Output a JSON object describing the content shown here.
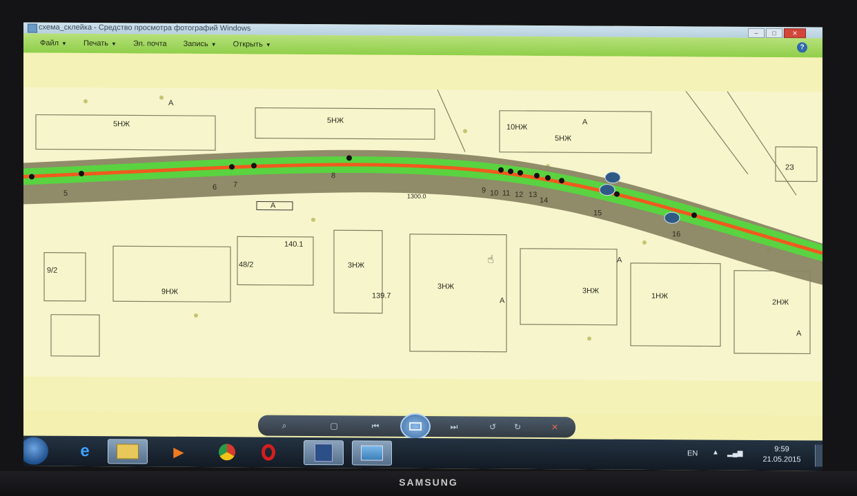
{
  "window": {
    "title": "схема_склейка - Средство просмотра фотографий Windows",
    "controls": {
      "minimize": "–",
      "maximize": "□",
      "close": "✕"
    }
  },
  "menu": {
    "items": [
      {
        "label": "Файл",
        "has_dropdown": true
      },
      {
        "label": "Печать",
        "has_dropdown": true
      },
      {
        "label": "Эл. почта",
        "has_dropdown": false
      },
      {
        "label": "Запись",
        "has_dropdown": true
      },
      {
        "label": "Открыть",
        "has_dropdown": true
      }
    ],
    "help_icon": "?"
  },
  "map": {
    "building_labels": [
      "5НЖ",
      "5НЖ",
      "10НЖ",
      "5НЖ",
      "2З",
      "9НЖ",
      "3НЖ",
      "3НЖ",
      "3НЖ",
      "1НЖ",
      "2НЖ",
      "А",
      "А",
      "А",
      "А",
      "А"
    ],
    "numbers": [
      "9/2",
      "48/2",
      "140.1",
      "139.7",
      "1300.0"
    ],
    "route_points": [
      "5",
      "6",
      "7",
      "8",
      "9",
      "10",
      "11",
      "12",
      "13",
      "14",
      "15",
      "16"
    ],
    "road_marker": "А"
  },
  "viewer_controls": [
    "magnifier-icon",
    "fit-icon",
    "previous-icon",
    "slideshow-icon",
    "next-icon",
    "rotate-left-icon",
    "rotate-right-icon",
    "delete-icon"
  ],
  "taskbar": {
    "apps": [
      "internet-explorer-icon",
      "folder-icon",
      "media-player-icon",
      "chrome-icon",
      "opera-icon",
      "floppy-disk-icon",
      "photo-viewer-icon"
    ],
    "language": "EN",
    "time": "9:59",
    "date": "21.05.2015"
  },
  "monitor": {
    "brand": "SAMSUNG"
  },
  "colors": {
    "green_strip": "#59d340",
    "route_line": "#f05a1e",
    "road": "#8a8563",
    "map_bg": "#f4f2b6",
    "menubar": "#9fd65a"
  }
}
